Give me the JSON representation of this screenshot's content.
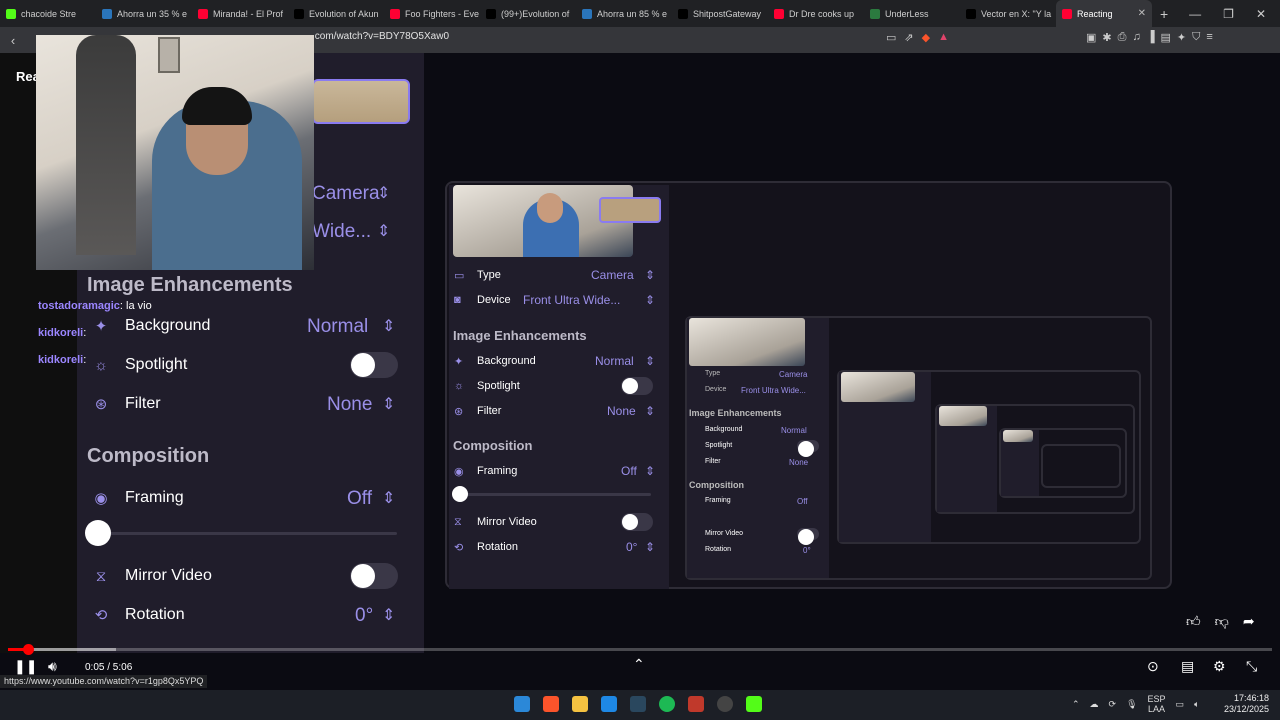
{
  "browser": {
    "tabs": [
      {
        "label": "chacoide Stre",
        "color": "#53fc18"
      },
      {
        "label": "Ahorra un 35 % e",
        "color": "#2a75bb"
      },
      {
        "label": "Miranda! - El Prof",
        "color": "#ff0033"
      },
      {
        "label": "Evolution of Akun",
        "color": "#000000"
      },
      {
        "label": "Foo Fighters - Eve",
        "color": "#ff0033"
      },
      {
        "label": "(99+)Evolution of",
        "color": "#000000"
      },
      {
        "label": "Ahorra un 85 % e",
        "color": "#2a75bb"
      },
      {
        "label": "ShitpostGateway",
        "color": "#000000"
      },
      {
        "label": "Dr Dre cooks up",
        "color": "#ff0033"
      },
      {
        "label": "UnderLess",
        "color": "#2b7a3f"
      },
      {
        "label": "Vector en X: \"Y la",
        "color": "#000000"
      },
      {
        "label": "Reacting",
        "color": "#ff0033",
        "active": true
      }
    ],
    "new_tab": "+",
    "url": ".com/watch?v=BDY78O5Xaw0",
    "status_url": "https://www.youtube.com/watch?v=r1gp8Qx5YPQ"
  },
  "youtube": {
    "sidebar_label": "Rea"
  },
  "video": {
    "left_panel": {
      "type_value": "Camera",
      "device_value": "Wide...",
      "section_image": "Image Enhancements",
      "background_label": "Background",
      "background_value": "Normal",
      "spotlight_label": "Spotlight",
      "filter_label": "Filter",
      "filter_value": "None",
      "section_composition": "Composition",
      "framing_label": "Framing",
      "framing_value": "Off",
      "mirror_label": "Mirror Video",
      "rotation_label": "Rotation",
      "rotation_value": "0°"
    },
    "chat": [
      {
        "user": "tostadoramagic",
        "msg": "la vio"
      },
      {
        "user": "kidkoreli",
        "msg": ""
      },
      {
        "user": "kidkoreli",
        "msg": ""
      }
    ],
    "right_panel": {
      "type_label": "Type",
      "type_value": "Camera",
      "device_label": "Device",
      "device_value": "Front Ultra Wide...",
      "section_image": "Image Enhancements",
      "background_label": "Background",
      "background_value": "Normal",
      "spotlight_label": "Spotlight",
      "filter_label": "Filter",
      "filter_value": "None",
      "section_composition": "Composition",
      "framing_label": "Framing",
      "framing_value": "Off",
      "mirror_label": "Mirror Video",
      "rotation_label": "Rotation",
      "rotation_value": "0°"
    },
    "nested": {
      "type_label": "Type",
      "type_value": "Camera",
      "device_label": "Device",
      "device_value": "Front Ultra Wide...",
      "section_image": "Image Enhancements",
      "background_label": "Background",
      "background_value": "Normal",
      "spotlight_label": "Spotlight",
      "filter_label": "Filter",
      "filter_value": "None",
      "section_composition": "Composition",
      "framing_label": "Framing",
      "framing_value": "Off",
      "mirror_label": "Mirror Video",
      "rotation_label": "Rotation",
      "rotation_value": "0°"
    }
  },
  "player": {
    "time": "0:05 / 5:06",
    "progress_fraction": 0.016
  },
  "taskbar": {
    "lang_top": "ESP",
    "lang_bottom": "LAA",
    "time": "17:46:18",
    "date": "23/12/2025"
  }
}
